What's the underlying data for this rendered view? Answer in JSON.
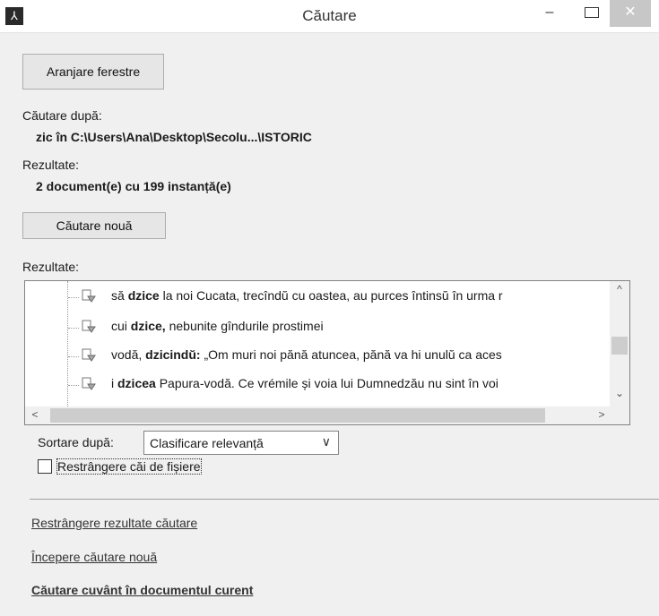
{
  "window": {
    "title": "Căutare",
    "app_icon_glyph": "⅄",
    "minimize_glyph": "–",
    "close_glyph": "✕"
  },
  "buttons": {
    "arrange_windows": "Aranjare ferestre",
    "new_search": "Căutare nouă"
  },
  "search_for": {
    "label": "Căutare după:",
    "value": "zic în C:\\Users\\Ana\\Desktop\\Secolu...\\ISTORIC"
  },
  "results_summary": {
    "label": "Rezultate:",
    "value": "2 document(e) cu 199 instanță(e)"
  },
  "results_list": {
    "label": "Rezultate:",
    "rows": [
      {
        "before": "să ",
        "match": "dzice",
        "after": " la noi Cucata, trecîndŭ cu oastea, au purces întinsŭ în urma r"
      },
      {
        "before": "cui ",
        "match": "dzice,",
        "after": " nebunite gîndurile prostimei"
      },
      {
        "before": "vodă, ",
        "match": "dzicindŭ:",
        "after": " „Om muri noi pănă atuncea, pănă va hi unulŭ ca aces"
      },
      {
        "before": "i ",
        "match": "dzicea",
        "after": " Papura-vodă. Ce vrémile și voia lui Dumnedzău nu sint în voi"
      }
    ],
    "scroll_up": "^",
    "scroll_down": "⌄",
    "scroll_left": "<",
    "scroll_right": ">"
  },
  "sort": {
    "label": "Sortare după:",
    "selected": "Clasificare relevanță",
    "chevron": "∨"
  },
  "restrict_paths": {
    "label": "Restrângere căi de fișiere",
    "checked": false
  },
  "links": {
    "restrict_results": "Restrângere rezultate căutare",
    "start_new_search": "Începere căutare nouă",
    "search_current_doc": "Căutare cuvânt în documentul curent"
  },
  "colors": {
    "close_button": "#c7c7c7",
    "background": "#f0f0f0"
  }
}
